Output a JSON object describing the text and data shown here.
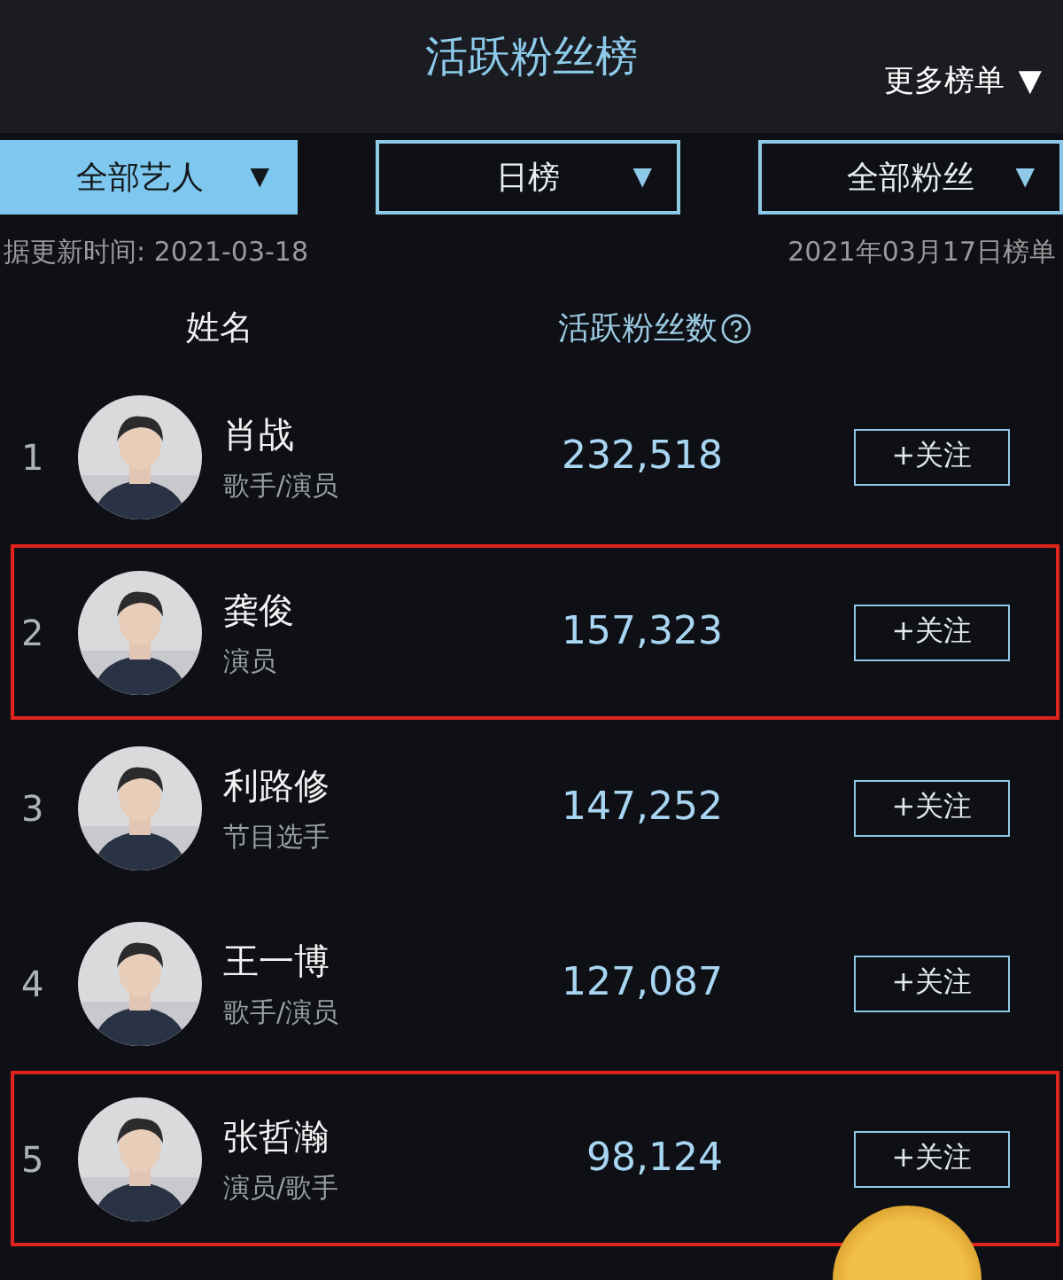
{
  "header": {
    "title": "活跃粉丝榜",
    "more": "更多榜单",
    "more_caret": "▼"
  },
  "filters": [
    {
      "label": "全部艺人",
      "caret": "▼",
      "selected": true
    },
    {
      "label": "日榜",
      "caret": "▼",
      "selected": false
    },
    {
      "label": "全部粉丝",
      "caret": "▼",
      "selected": false
    }
  ],
  "update_time": "据更新时间: 2021-03-18",
  "list_date": "2021年03月17日榜单",
  "columns": {
    "name": "姓名",
    "fans": "活跃粉丝数"
  },
  "rows": [
    {
      "rank": "1",
      "name": "肖战",
      "role": "歌手/演员",
      "fans": "232,518",
      "follow": "+关注",
      "highlighted": false
    },
    {
      "rank": "2",
      "name": "龚俊",
      "role": "演员",
      "fans": "157,323",
      "follow": "+关注",
      "highlighted": true
    },
    {
      "rank": "3",
      "name": "利路修",
      "role": "节目选手",
      "fans": "147,252",
      "follow": "+关注",
      "highlighted": false
    },
    {
      "rank": "4",
      "name": "王一博",
      "role": "歌手/演员",
      "fans": "127,087",
      "follow": "+关注",
      "highlighted": false
    },
    {
      "rank": "5",
      "name": "张哲瀚",
      "role": "演员/歌手",
      "fans": "98,124",
      "follow": "+关注",
      "highlighted": true
    }
  ]
}
